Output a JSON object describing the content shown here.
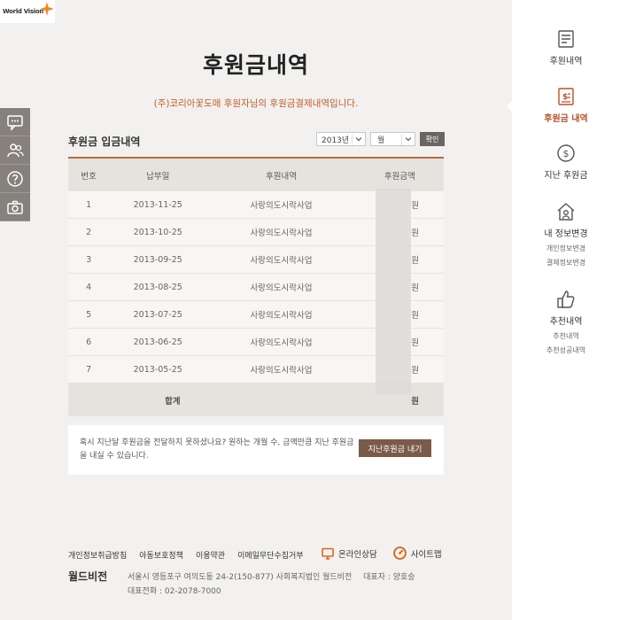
{
  "brand": {
    "logo_text": "World Vision",
    "korean_name": "월드비전"
  },
  "page": {
    "title": "후원금내역",
    "notice": "(주)코리아꽃도매 후원자님의 후원금결제내역입니다."
  },
  "section": {
    "title": "후원금 입금내역",
    "year_value": "2013년",
    "month_value": "월",
    "confirm_label": "확인"
  },
  "table": {
    "headers": [
      "번호",
      "납부일",
      "후원내역",
      "후원금액"
    ],
    "rows": [
      {
        "no": "1",
        "date": "2013-11-25",
        "item": "사랑의도시락사업",
        "amount": "원"
      },
      {
        "no": "2",
        "date": "2013-10-25",
        "item": "사랑의도시락사업",
        "amount": "원"
      },
      {
        "no": "3",
        "date": "2013-09-25",
        "item": "사랑의도시락사업",
        "amount": "원"
      },
      {
        "no": "4",
        "date": "2013-08-25",
        "item": "사랑의도시락사업",
        "amount": "원"
      },
      {
        "no": "5",
        "date": "2013-07-25",
        "item": "사랑의도시락사업",
        "amount": "원"
      },
      {
        "no": "6",
        "date": "2013-06-25",
        "item": "사랑의도시락사업",
        "amount": "원"
      },
      {
        "no": "7",
        "date": "2013-05-25",
        "item": "사랑의도시락사업",
        "amount": "원"
      }
    ],
    "total_label": "합계",
    "total_amount": "원"
  },
  "info": {
    "message": "혹시 지난달 후원금을 전달하지 못하셨나요? 원하는 개월 수, 금액만큼 지난 후원금을 내실 수 있습니다.",
    "button_label": "지난후원금 내기"
  },
  "footer": {
    "links": [
      "개인정보취급방침",
      "아동보호정책",
      "이용약관",
      "이메일무단수집거부"
    ],
    "consult_label": "온라인상담",
    "sitemap_label": "사이트맵",
    "address": "서울시 영등포구 여의도동 24-2(150-877) 사회복지법인 월드비전",
    "ceo": "대표자 : 양호승",
    "phone": "대표전화 : 02-2078-7000"
  },
  "sidebar": {
    "history": "후원내역",
    "donation_history": "후원금 내역",
    "past_donation": "지난 후원금",
    "my_info": "내 정보변경",
    "my_info_sub1": "개인정보변경",
    "my_info_sub2": "결제정보변경",
    "recommend": "추천내역",
    "recommend_sub1": "추천내역",
    "recommend_sub2": "추천성공내역"
  },
  "colors": {
    "accent": "#b8502a",
    "button_dark": "#7a5b4a",
    "sidebar_icon_bg": "#86817d"
  },
  "left_icons": [
    "chat-icon",
    "people-icon",
    "question-icon",
    "camera-icon"
  ]
}
